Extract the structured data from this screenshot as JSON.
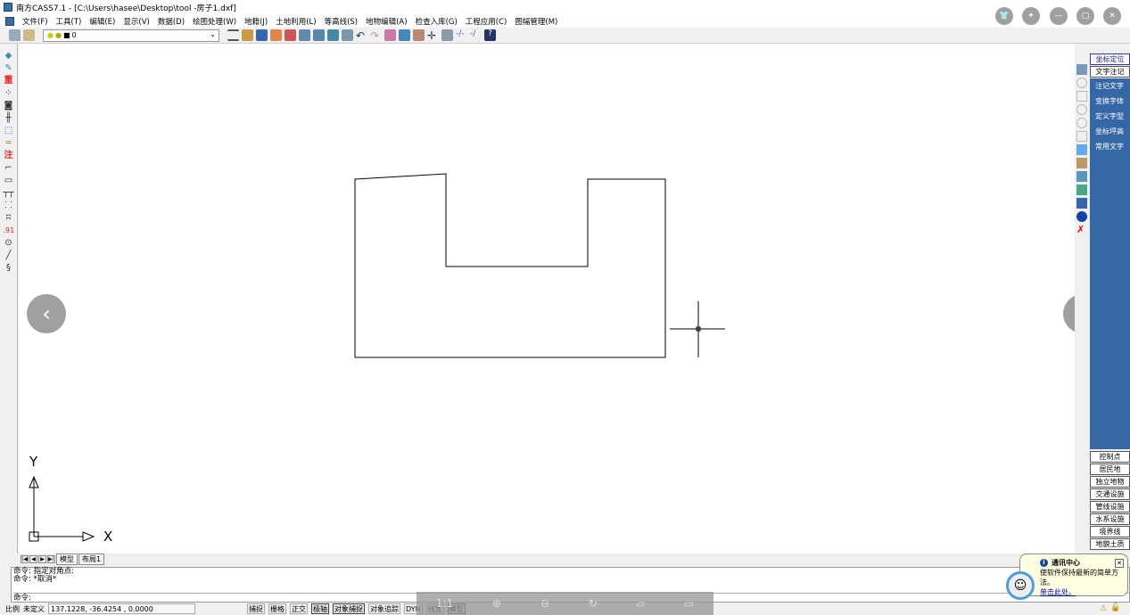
{
  "title": "南方CASS7.1 - [C:\\Users\\hasee\\Desktop\\tool -房子1.dxf]",
  "menu": [
    "文件(F)",
    "工具(T)",
    "编辑(E)",
    "显示(V)",
    "数据(D)",
    "绘图处理(W)",
    "地籍(J)",
    "土地利用(L)",
    "等高线(S)",
    "地物编辑(A)",
    "检查入库(G)",
    "工程应用(C)",
    "图幅管理(M)"
  ],
  "layer": {
    "value": "0"
  },
  "left_toolbar": [
    "重",
    "注",
    ".91"
  ],
  "right_panel": {
    "top_buttons": [
      "坐标定位",
      "文字注记"
    ],
    "items": [
      "注记文字",
      "变换字体",
      "定义字型",
      "坐标坪高",
      "常用文字"
    ],
    "categories": [
      "控制点",
      "居民地",
      "独立地物",
      "交通设施",
      "管线设施",
      "水系设施",
      "境界线",
      "地貌土质"
    ]
  },
  "tabs": [
    "模型",
    "布局1"
  ],
  "command": {
    "lines": [
      "命令: 指定对角点:",
      "命令: *取消*"
    ],
    "prompt": "命令:"
  },
  "status": {
    "scale_label": "比例",
    "scale_value": "未定义",
    "coords": "137.1228, -36.4254 , 0.0000",
    "toggles": [
      {
        "label": "捕捉",
        "on": false
      },
      {
        "label": "栅格",
        "on": false
      },
      {
        "label": "正交",
        "on": false
      },
      {
        "label": "极轴",
        "on": true
      },
      {
        "label": "对象捕捉",
        "on": true
      },
      {
        "label": "对象追踪",
        "on": false
      },
      {
        "label": "DYN",
        "on": false
      },
      {
        "label": "线宽",
        "on": false
      },
      {
        "label": "模型",
        "on": true
      }
    ]
  },
  "viewer": {
    "ratio": "1:1"
  },
  "notification": {
    "title": "通讯中心",
    "text": "使软件保持最新的简单方法。",
    "link": "单击此处。"
  },
  "axis": {
    "x": "X",
    "y": "Y"
  }
}
